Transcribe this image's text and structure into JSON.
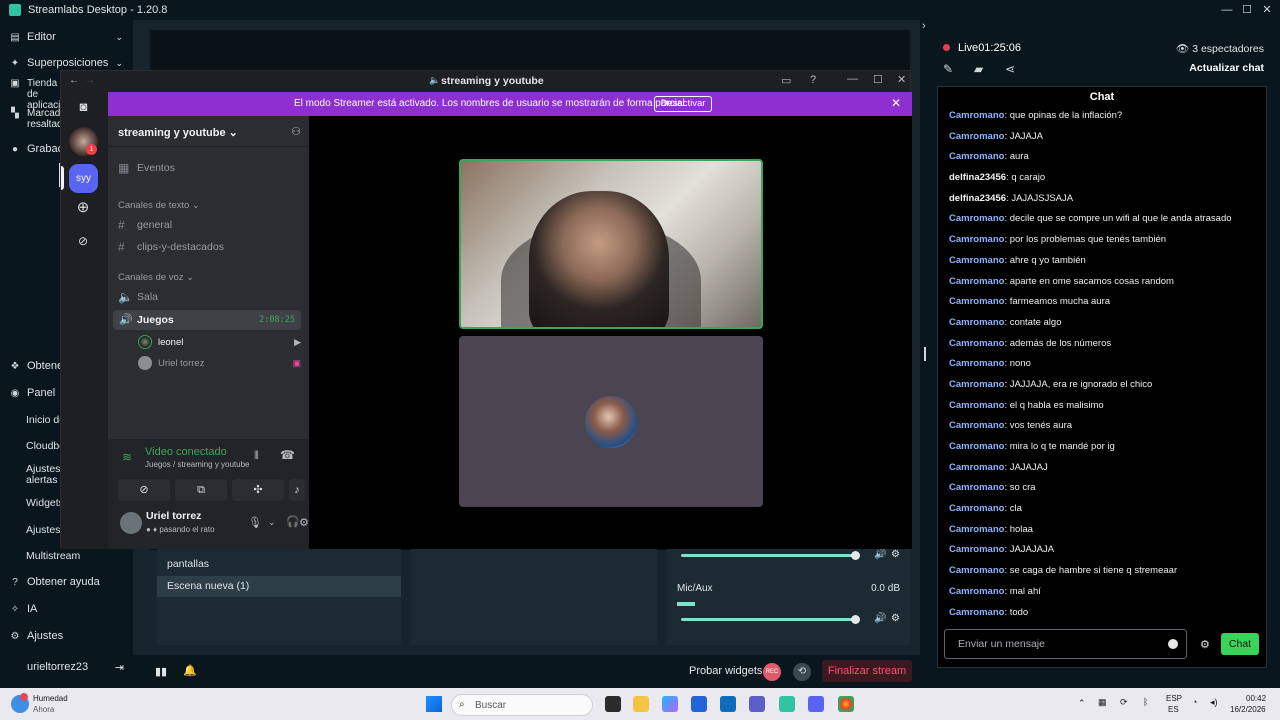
{
  "app": {
    "title": "Streamlabs Desktop - 1.20.8"
  },
  "nav": {
    "items": [
      "Editor",
      "Superposiciones",
      "Tienda de aplicaci",
      "Marcado resaltad",
      "Grabaci"
    ],
    "bottom": [
      "Obtener",
      "Panel"
    ],
    "sub": [
      "Inicio de",
      "Cloudbo",
      "Ajustes alertas",
      "Widgets",
      "Ajustes",
      "Multistream"
    ],
    "footer": [
      "Obtener ayuda",
      "IA",
      "Ajustes"
    ],
    "username": "urieltorrez23"
  },
  "scenes": {
    "items": [
      "pantallas",
      "Escena nueva (1)"
    ]
  },
  "mixer": {
    "mic_label": "Mic/Aux",
    "mic_db": "0.0 dB",
    "level_1": 0.9,
    "level_2": 0.9
  },
  "footer": {
    "probar": "Probar widgets",
    "rec": "REC",
    "finalizar": "Finalizar stream"
  },
  "live": {
    "status": "Live",
    "time": "01:25:06",
    "viewers": "3 espectadores",
    "refresh": "Actualizar chat"
  },
  "chat": {
    "title": "Chat",
    "messages": [
      {
        "user": "Camromano",
        "text": ": que opinas de la inflación?"
      },
      {
        "user": "Camromano",
        "text": ": JAJAJA"
      },
      {
        "user": "Camromano",
        "text": ": aura"
      },
      {
        "user": "delfina23456",
        "text": ": q carajo"
      },
      {
        "user": "delfina23456",
        "text": ": JAJAJSJSAJA"
      },
      {
        "user": "Camromano",
        "text": ": decile que se compre un wifi al que le anda atrasado"
      },
      {
        "user": "Camromano",
        "text": ": por los problemas que tenés también"
      },
      {
        "user": "Camromano",
        "text": ": ahre q yo también"
      },
      {
        "user": "Camromano",
        "text": ": aparte en ome sacamos cosas random"
      },
      {
        "user": "Camromano",
        "text": ": farmeamos mucha aura"
      },
      {
        "user": "Camromano",
        "text": ": contate algo"
      },
      {
        "user": "Camromano",
        "text": ": además de los números"
      },
      {
        "user": "Camromano",
        "text": ": nono"
      },
      {
        "user": "Camromano",
        "text": ": JAJJAJA, era re ignorado el chico"
      },
      {
        "user": "Camromano",
        "text": ": el q habla es malisimo"
      },
      {
        "user": "Camromano",
        "text": ": vos tenés aura"
      },
      {
        "user": "Camromano",
        "text": ": mira lo q te mandé por ig"
      },
      {
        "user": "Camromano",
        "text": ": JAJAJAJ"
      },
      {
        "user": "Camromano",
        "text": ": so cra"
      },
      {
        "user": "Camromano",
        "text": ": cla"
      },
      {
        "user": "Camromano",
        "text": ": holaa"
      },
      {
        "user": "Camromano",
        "text": ": JAJAJAJA"
      },
      {
        "user": "Camromano",
        "text": ": se caga de hambre si tiene q stremeaar"
      },
      {
        "user": "Camromano",
        "text": ": mal ahí"
      },
      {
        "user": "Camromano",
        "text": ": todo"
      }
    ],
    "input_placeholder": "Enviar un mensaje",
    "send": "Chat"
  },
  "discord": {
    "title": "streaming y youtube",
    "banner": "El modo Streamer está activado. Los nombres de usuario se mostrarán de forma parcial.",
    "banner_button": "Desactivar",
    "server_badge": "1",
    "server_acronym": "syy",
    "guild": "streaming y youtube",
    "events": "Eventos",
    "text_category": "Canales de texto",
    "text_channels": [
      "general",
      "clips-y-destacados"
    ],
    "voice_category": "Canales de voz",
    "voice_channels": [
      "Sala",
      "Juegos"
    ],
    "voice_time": "2:08:25",
    "members": [
      "leonel",
      "Uriel torrez"
    ],
    "video_connected": "Video conectado",
    "voice_sub": "Juegos / streaming y youtube",
    "user": "Uriel torrez",
    "user_status": "pasando el rato"
  },
  "taskbar": {
    "weather": "Humedad",
    "weather_sub": "Ahora",
    "search": "Buscar",
    "lang": "ESP",
    "lang_sub": "ES",
    "time": "00:42",
    "date": "16/2/2026"
  }
}
